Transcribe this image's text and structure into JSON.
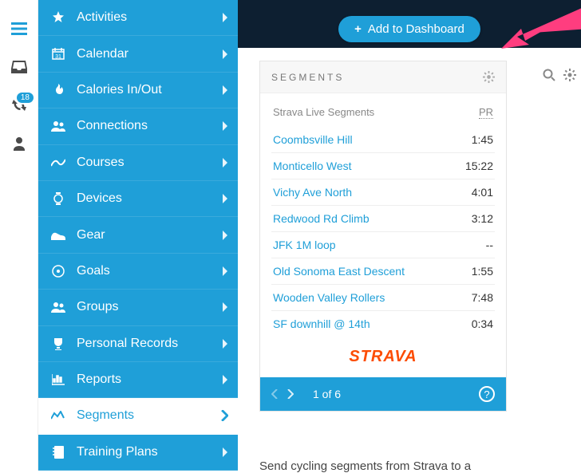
{
  "rail": {
    "notification_count": "18"
  },
  "sidebar": {
    "items": [
      {
        "label": "Activities"
      },
      {
        "label": "Calendar"
      },
      {
        "label": "Calories In/Out"
      },
      {
        "label": "Connections"
      },
      {
        "label": "Courses"
      },
      {
        "label": "Devices"
      },
      {
        "label": "Gear"
      },
      {
        "label": "Goals"
      },
      {
        "label": "Groups"
      },
      {
        "label": "Personal Records"
      },
      {
        "label": "Reports"
      },
      {
        "label": "Segments"
      },
      {
        "label": "Training Plans"
      }
    ],
    "active_index": 11
  },
  "add_button": {
    "label": "Add to Dashboard"
  },
  "card": {
    "title": "SEGMENTS",
    "subhead_left": "Strava Live Segments",
    "subhead_right": "PR",
    "rows": [
      {
        "name": "Coombsville Hill",
        "time": "1:45"
      },
      {
        "name": "Monticello West",
        "time": "15:22"
      },
      {
        "name": "Vichy Ave North",
        "time": "4:01"
      },
      {
        "name": "Redwood Rd Climb",
        "time": "3:12"
      },
      {
        "name": "JFK 1M loop",
        "time": "--"
      },
      {
        "name": "Old Sonoma East Descent",
        "time": "1:55"
      },
      {
        "name": "Wooden Valley Rollers",
        "time": "7:48"
      },
      {
        "name": "SF downhill @ 14th",
        "time": "0:34"
      }
    ],
    "brand": "STRAVA",
    "pager": {
      "label": "1 of 6"
    }
  },
  "below_text": "Send cycling segments from Strava to a"
}
